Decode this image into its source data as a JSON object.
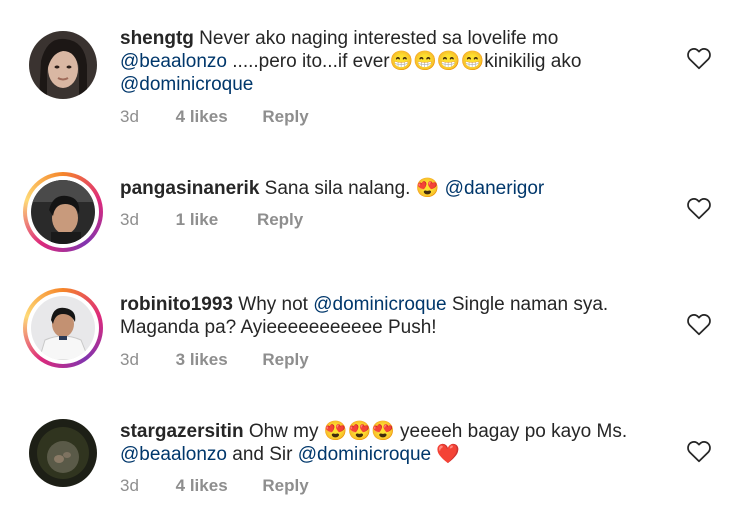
{
  "comments": [
    {
      "username": "shengtg",
      "text1": "Never ako naging interested sa lovelife mo",
      "mention1": "@beaalonzo",
      "text2": " .....pero ito...if ever",
      "emojis": "😁😁😁😁",
      "text3": "kinikilig ako",
      "mention2": "@dominicroque",
      "time": "3d",
      "likes": "4 likes",
      "reply": "Reply"
    },
    {
      "username": "pangasinanerik",
      "text1": " Sana sila nalang. ",
      "emojis": "😍",
      "mention1": " @danerigor",
      "time": "3d",
      "likes": "1 like",
      "reply": "Reply"
    },
    {
      "username": "robinito1993",
      "text1": " Why not ",
      "mention1": "@dominicroque",
      "text2": " Single naman sya.",
      "text3": "Maganda pa? Ayieeeeeeeeeee Push!",
      "time": "3d",
      "likes": "3 likes",
      "reply": "Reply"
    },
    {
      "username": "stargazersitin",
      "text1": " Ohw my ",
      "emojis": "😍😍😍",
      "text2": " yeeeeh bagay po kayo Ms.",
      "mention1": "@beaalonzo",
      "text3": "  and Sir ",
      "mention2": "@dominicroque",
      "emoji2": " ❤️",
      "time": "3d",
      "likes": "4 likes",
      "reply": "Reply"
    }
  ],
  "icons": {
    "like": "heart-outline-icon"
  },
  "colors": {
    "text": "#262626",
    "muted": "#8e8e8e",
    "mention": "#00376b"
  }
}
